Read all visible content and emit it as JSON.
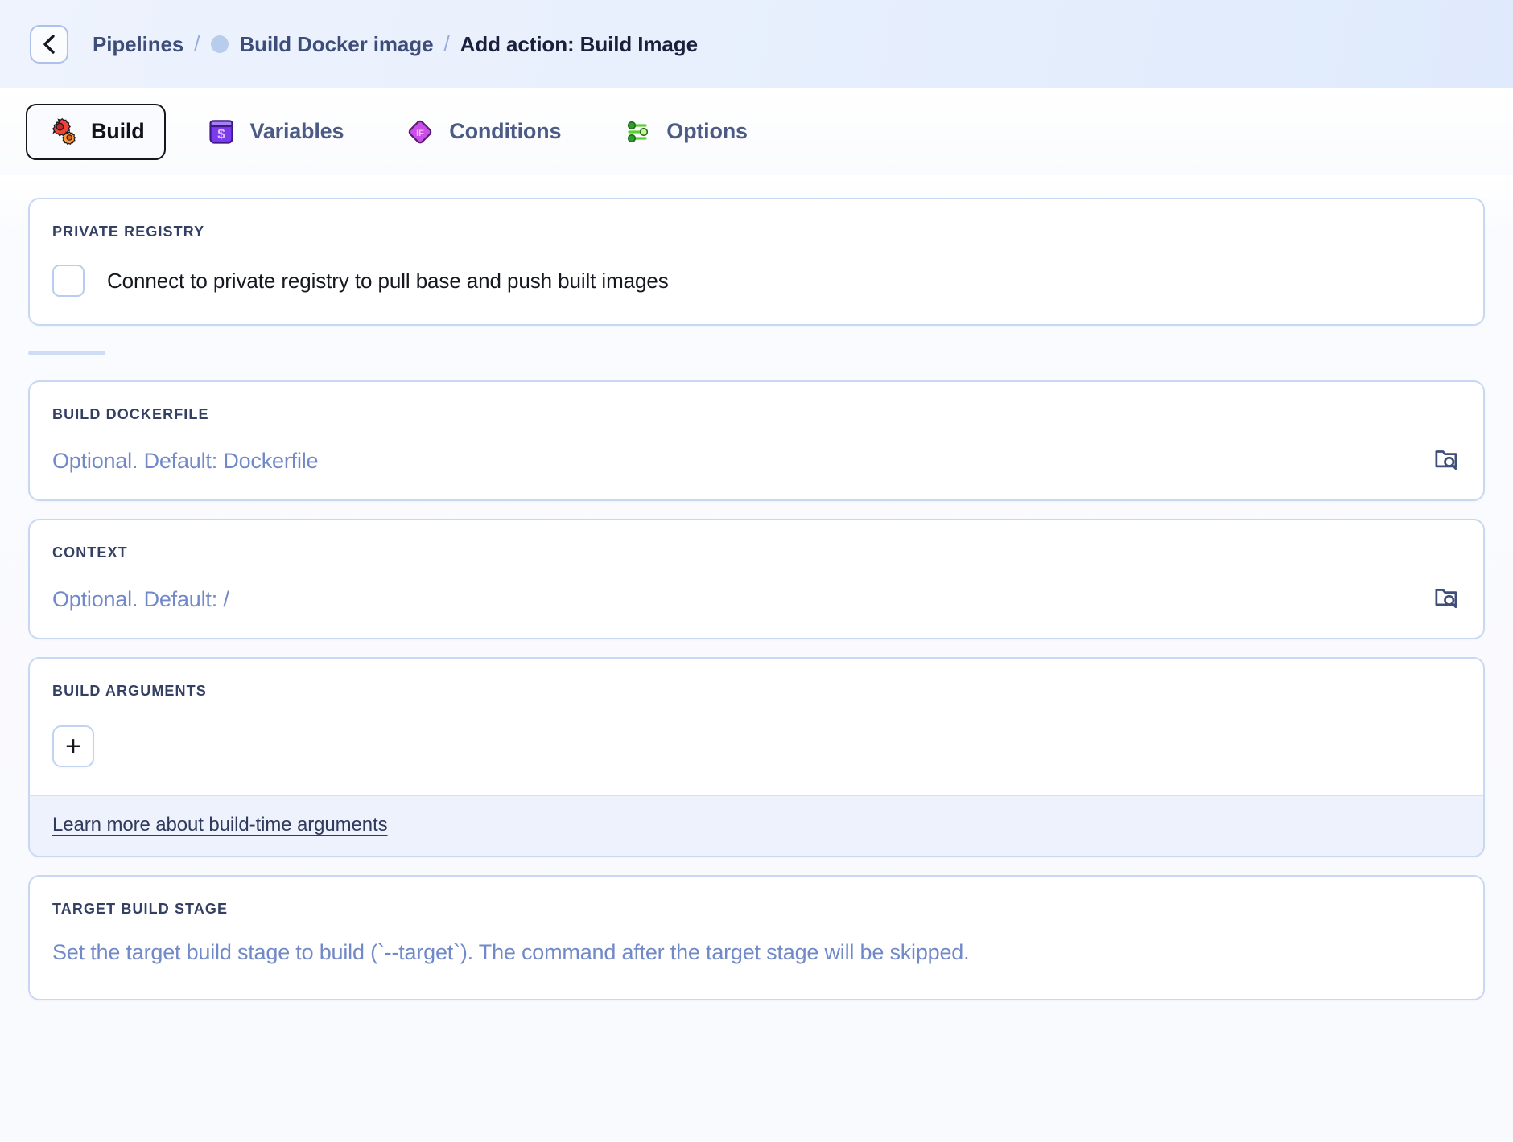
{
  "header": {
    "back_icon": "chevron-left-icon",
    "breadcrumb": {
      "root": "Pipelines",
      "separator": "/",
      "pipeline": "Build Docker image",
      "pipeline_status_icon": "status-dot-icon",
      "current": "Add action: Build Image"
    }
  },
  "tabs": [
    {
      "label": "Build",
      "icon": "gears-icon",
      "active": true
    },
    {
      "label": "Variables",
      "icon": "dollar-square-icon",
      "active": false
    },
    {
      "label": "Conditions",
      "icon": "if-diamond-icon",
      "active": false
    },
    {
      "label": "Options",
      "icon": "sliders-icon",
      "active": false
    }
  ],
  "sections": {
    "private_registry": {
      "label": "PRIVATE REGISTRY",
      "checkbox_label": "Connect to private registry to pull base and push built images",
      "checked": false
    },
    "build_dockerfile": {
      "label": "BUILD DOCKERFILE",
      "value": "",
      "placeholder": "Optional. Default: Dockerfile",
      "browse_icon": "folder-search-icon"
    },
    "context": {
      "label": "CONTEXT",
      "value": "",
      "placeholder": "Optional. Default: /",
      "browse_icon": "folder-search-icon"
    },
    "build_arguments": {
      "label": "BUILD ARGUMENTS",
      "add_button_label": "+",
      "footer_link": "Learn more about build-time arguments"
    },
    "target_build_stage": {
      "label": "TARGET BUILD STAGE",
      "value": "",
      "placeholder": "Set the target build stage to build (`--target`). The command after the target stage will be skipped."
    }
  },
  "colors": {
    "accent": "#3d4d7a",
    "card_border": "#c9d8f2",
    "placeholder": "#7289c9",
    "footer_bg": "#eef2fc"
  }
}
